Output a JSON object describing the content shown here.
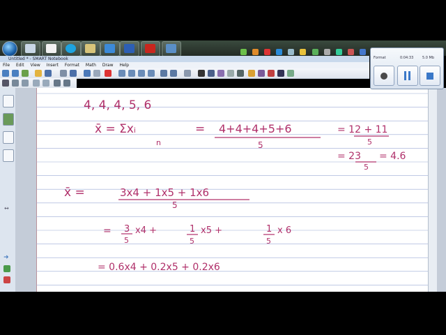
{
  "window": {
    "title": "Untitled * - SMART Notebook"
  },
  "menu": {
    "items": [
      "File",
      "Edit",
      "View",
      "Insert",
      "Format",
      "Math",
      "Draw",
      "Help"
    ]
  },
  "recorder": {
    "format": "Format",
    "elapsed": "0:04:33",
    "size": "5.0 Mb"
  },
  "colors": {
    "ink": "#b0306a",
    "rule_line": "#9aa9d6",
    "margin_line": "#d98aa0"
  },
  "notes": {
    "line1": "4, 4, 4, 5, 6",
    "line2_lhs": "x̄ = Σxᵢ",
    "line2_den": "n",
    "line2_num": "4+4+4+5+6",
    "line2_den2": "5",
    "line2_r1_num": "= 12 + 11",
    "line2_r1_den": "5",
    "line3_num": "= 23",
    "line3_den": "5",
    "line3_res": "= 4.6",
    "line4_lhs": "x̄ =",
    "line4_num": "3x4 + 1x5 + 1x6",
    "line4_den": "5",
    "line5_eq": "=",
    "line5_a_num": "3",
    "line5_a_den": "5",
    "line5_a_rest": "x4 +",
    "line5_b_num": "1",
    "line5_b_den": "5",
    "line5_b_rest": "x5 +",
    "line5_c_num": "1",
    "line5_c_den": "5",
    "line5_c_rest": "x 6",
    "line6": "= 0.6x4  + 0.2x5  + 0.2x6"
  }
}
